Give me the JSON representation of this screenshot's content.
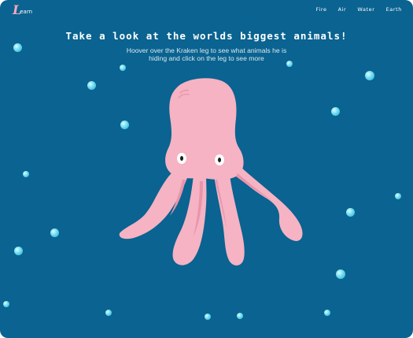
{
  "header": {
    "logo_letter": "L",
    "logo_rest": "earn",
    "nav": [
      "Fire",
      "Air",
      "Water",
      "Earth"
    ]
  },
  "hero": {
    "title": "Take a look at the worlds biggest animals!",
    "subtitle_line1": "Hoover over the Kraken leg to see what animals he is",
    "subtitle_line2": "hiding and click on the leg to see more"
  },
  "colors": {
    "background": "#0a6390",
    "kraken": "#f5b3c3",
    "logo": "#f3aabd"
  }
}
